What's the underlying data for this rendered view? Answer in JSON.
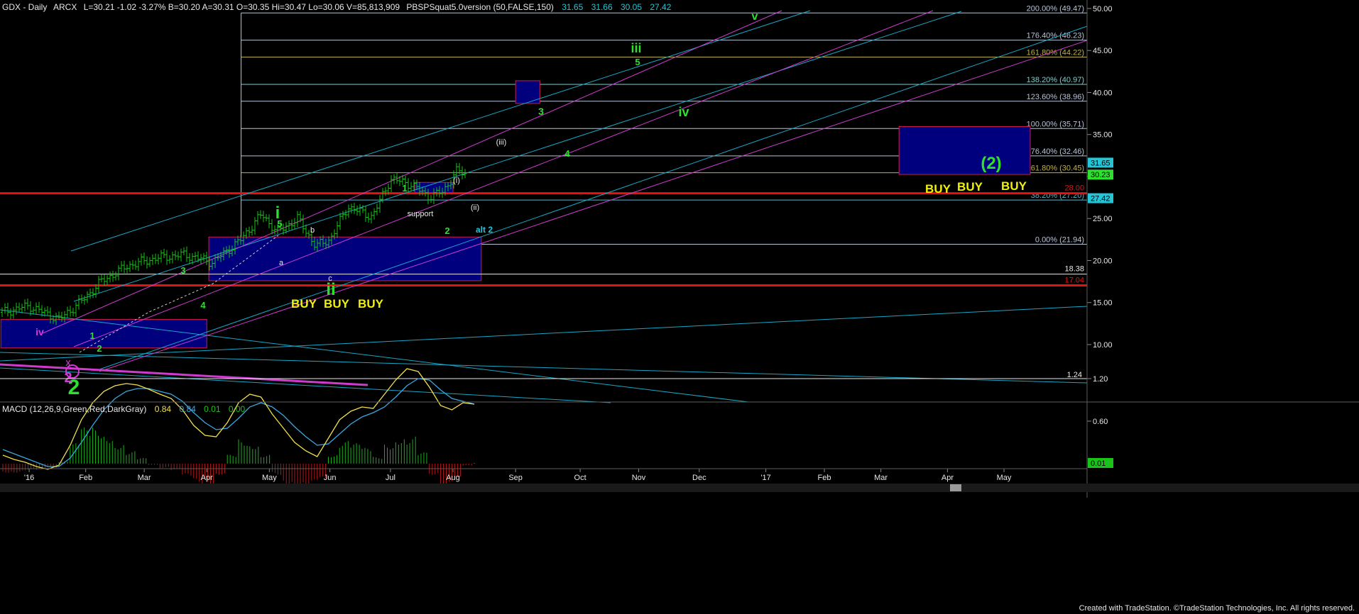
{
  "colors": {
    "background": "#000000",
    "price_bar": "#19c419",
    "red_level": "#e81010",
    "cyan_channel": "#17a7c7",
    "magenta_channel": "#d03ad0",
    "fib_line": "#b8c4d8",
    "box_fill": "#00007e",
    "box_edge": "#d01a4a",
    "wave_green": "#2ee02e",
    "buy_yellow": "#f0f000",
    "macd_fast": "#f2e04a",
    "macd_slow": "#3aa7e0",
    "hist": "#19b019"
  },
  "header": {
    "symbol": "GDX - Daily",
    "exchange": "ARCX",
    "quote": "L=30.21  -1.02  -3.27%  B=30.20  A=30.31  O=30.35  Hi=30.47  Lo=30.06  V=85,813,909",
    "indicator": "PBSPSquat5.0version (50,FALSE,150)",
    "indicator_values": [
      "31.65",
      "31.66",
      "30.05",
      "27.42"
    ]
  },
  "macd": {
    "label": "MACD (12,26,9,Green,Red,DarkGray)",
    "values": [
      "0.84",
      "0.84",
      "0.01",
      "0.00"
    ],
    "axis_ticks": [
      "1.20",
      "0.60"
    ],
    "top_value": "1.24",
    "last_hist": "0.01",
    "fast": [
      0.12,
      0.06,
      0.02,
      -0.04,
      -0.08,
      -0.02,
      0.26,
      0.62,
      0.86,
      1.02,
      1.1,
      1.13,
      1.11,
      1.05,
      0.98,
      0.92,
      0.76,
      0.54,
      0.4,
      0.38,
      0.58,
      0.86,
      0.98,
      0.94,
      0.7,
      0.5,
      0.3,
      0.18,
      0.1,
      0.36,
      0.62,
      0.74,
      0.8,
      0.78,
      0.98,
      1.18,
      1.34,
      1.3,
      1.08,
      0.82,
      0.76,
      0.86,
      0.84
    ],
    "slow": [
      0.2,
      0.14,
      0.08,
      0.02,
      -0.04,
      -0.04,
      0.08,
      0.3,
      0.54,
      0.76,
      0.92,
      1.02,
      1.06,
      1.06,
      1.02,
      0.98,
      0.88,
      0.72,
      0.58,
      0.48,
      0.5,
      0.64,
      0.8,
      0.86,
      0.8,
      0.68,
      0.52,
      0.38,
      0.26,
      0.28,
      0.42,
      0.56,
      0.66,
      0.72,
      0.8,
      0.94,
      1.1,
      1.2,
      1.18,
      1.04,
      0.92,
      0.88,
      0.84
    ],
    "hist": [
      -0.08,
      -0.08,
      -0.06,
      -0.06,
      -0.04,
      0.02,
      0.18,
      0.32,
      0.32,
      0.26,
      0.18,
      0.11,
      0.05,
      -0.01,
      -0.04,
      -0.06,
      -0.12,
      -0.18,
      -0.18,
      -0.1,
      0.08,
      0.22,
      0.18,
      0.08,
      -0.1,
      -0.18,
      -0.22,
      -0.2,
      -0.16,
      0.08,
      0.2,
      0.18,
      0.14,
      0.06,
      0.18,
      0.24,
      0.24,
      0.1,
      -0.1,
      -0.22,
      -0.16,
      -0.02,
      0.01
    ]
  },
  "x_axis": {
    "labels": [
      "'16",
      "Feb",
      "Mar",
      "Apr",
      "May",
      "Jun",
      "Jul",
      "Aug",
      "Sep",
      "Oct",
      "Nov",
      "Dec",
      "'17",
      "Feb",
      "Mar",
      "Apr",
      "May"
    ]
  },
  "footer": {
    "credit": "Created with TradeStation. ©TradeStation Technologies, Inc. All rights reserved."
  },
  "chart_data": {
    "type": "candlestick",
    "x_unit": "trading date",
    "y_unit": "price (USD)",
    "ylim": [
      7.6,
      52.0
    ],
    "y_ticks": [
      10,
      15,
      20,
      25,
      30,
      35,
      40,
      45,
      50
    ],
    "y_tick_labels": [
      "10.00",
      "15.00",
      "20.00",
      "25.00",
      "30.00",
      "35.00",
      "40.00",
      "45.00",
      "50.00"
    ],
    "right_axis_markers": [
      {
        "label": "31.65",
        "price": 31.65,
        "color": "#22c6d8"
      },
      {
        "label": "30.23",
        "price": 30.23,
        "color": "#2ee02e"
      },
      {
        "label": "27.42",
        "price": 27.42,
        "color": "#22c6d8"
      }
    ],
    "price_series": {
      "dates": [
        "2015-12-21",
        "2016-01-04",
        "2016-01-19",
        "2016-02-01",
        "2016-02-08",
        "2016-02-22",
        "2016-03-07",
        "2016-03-21",
        "2016-04-04",
        "2016-04-18",
        "2016-04-28",
        "2016-05-06",
        "2016-05-16",
        "2016-05-25",
        "2016-06-01",
        "2016-06-10",
        "2016-06-22",
        "2016-07-01",
        "2016-07-11",
        "2016-07-20",
        "2016-07-27",
        "2016-08-03",
        "2016-08-08"
      ],
      "close": [
        13.8,
        14.6,
        13.0,
        15.6,
        17.4,
        19.4,
        20.3,
        20.7,
        19.8,
        22.5,
        25.5,
        23.4,
        25.0,
        21.7,
        22.5,
        26.4,
        25.2,
        29.7,
        29.1,
        27.6,
        28.2,
        30.7,
        30.2
      ]
    },
    "horizontal_levels": [
      {
        "label": "28.00",
        "price": 28.0,
        "style": "red"
      },
      {
        "label": "17.04",
        "price": 17.04,
        "style": "red"
      },
      {
        "label": "18.38",
        "price": 18.38,
        "style": "white"
      }
    ],
    "fib_levels": [
      {
        "label": "200.00% (49.47)",
        "price": 49.47,
        "color": "#b8c4d8"
      },
      {
        "label": "176.40% (46.23)",
        "price": 46.23,
        "color": "#b8c4d8"
      },
      {
        "label": "161.80% (44.22)",
        "price": 44.22,
        "color": "#bdb04a"
      },
      {
        "label": "138.20% (40.97)",
        "price": 40.97,
        "color": "#7fd0d0"
      },
      {
        "label": "123.60% (38.96)",
        "price": 38.96,
        "color": "#b8c4d8"
      },
      {
        "label": "100.00% (35.71)",
        "price": 35.71,
        "color": "#b8c4d8"
      },
      {
        "label": "76.40% (32.46)",
        "price": 32.46,
        "color": "#b8c4d8"
      },
      {
        "label": "61.80% (30.45)",
        "price": 30.45,
        "color": "#bdb04a"
      },
      {
        "label": "38.20% (27.20)",
        "price": 27.2,
        "color": "#5ab4c8"
      },
      {
        "label": "0.00% (21.94)",
        "price": 21.94,
        "color": "#b8c4d8"
      }
    ],
    "buy_labels": [
      "BUY",
      "BUY",
      "BUY"
    ],
    "support_label": "support",
    "wave_labels": {
      "primary_2": "2",
      "x": "x",
      "iv_small": "iv",
      "y": "y",
      "one": "1",
      "two": "2",
      "three": "3",
      "four": "4",
      "five": "5",
      "i": "i",
      "ii": "ii",
      "iii": "iii",
      "iv": "iv",
      "v": "v",
      "a": "a",
      "b": "b",
      "c": "c",
      "w_i": "(i)",
      "w_ii": "(ii)",
      "w_iii": "(iii)",
      "alt2": "alt 2",
      "big2": "(2)"
    }
  }
}
